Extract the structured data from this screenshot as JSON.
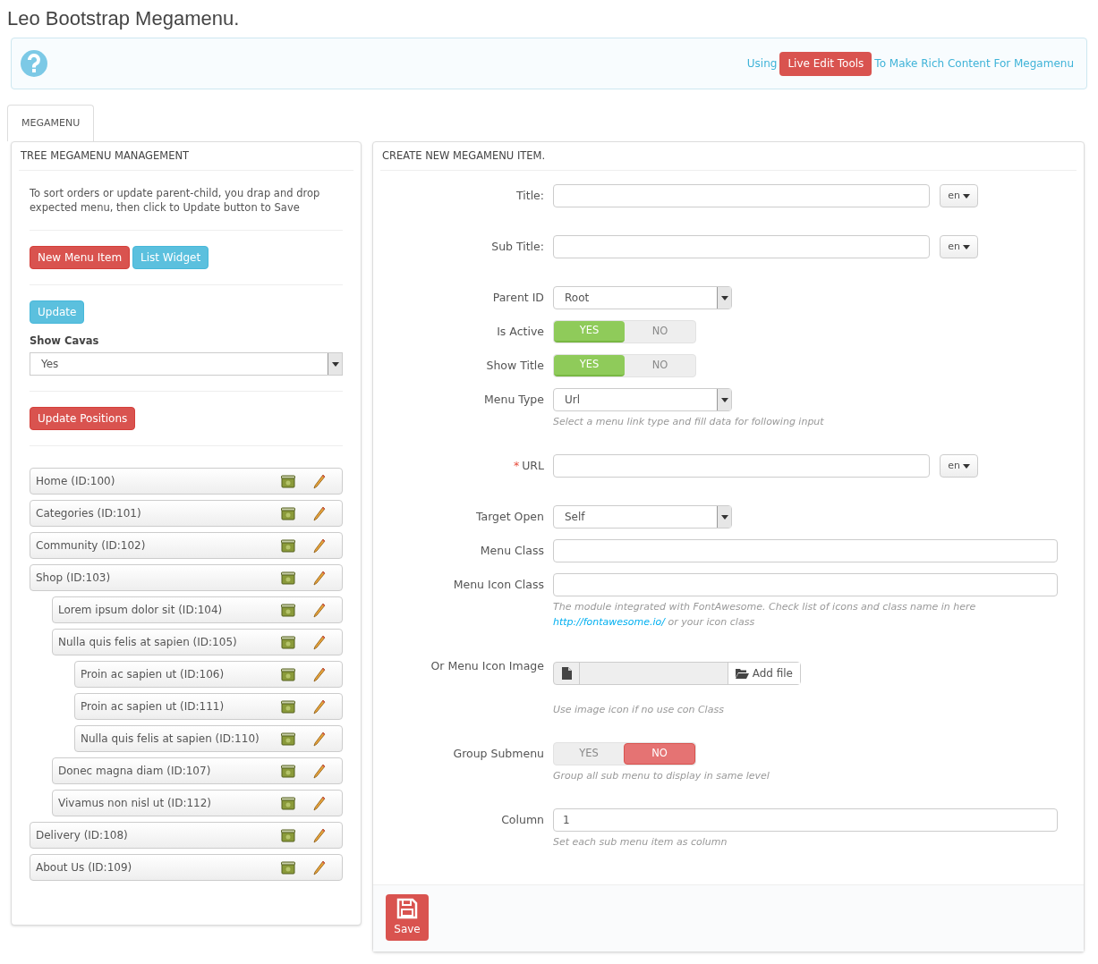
{
  "page_title": "Leo Bootstrap Megamenu.",
  "help_banner": {
    "before": "Using",
    "button": "Live Edit Tools",
    "after": "To Make Rich Content For Megamenu"
  },
  "tabs": [
    {
      "label": "MEGAMENU",
      "selected": true
    }
  ],
  "tree_panel": {
    "title": "TREE MEGAMENU MANAGEMENT",
    "intro": "To sort orders or update parent-child, you drap and drop expected menu, then click to Update button to Save",
    "buttons": [
      {
        "label": "New Menu Item",
        "kind": "danger"
      },
      {
        "label": "List Widget",
        "kind": "info"
      }
    ],
    "update_button": "Update",
    "show_cavas_label": "Show Cavas",
    "show_cavas_value": "Yes",
    "update_positions_button": "Update Positions",
    "items": [
      {
        "label": "Home (ID:100)"
      },
      {
        "label": "Categories (ID:101)"
      },
      {
        "label": "Community (ID:102)"
      },
      {
        "label": "Shop (ID:103)",
        "children": [
          {
            "label": "Lorem ipsum dolor sit (ID:104)"
          },
          {
            "label": "Nulla quis felis at sapien (ID:105)",
            "children": [
              {
                "label": "Proin ac sapien ut (ID:106)"
              },
              {
                "label": "Proin ac sapien ut (ID:111)"
              },
              {
                "label": "Nulla quis felis at sapien (ID:110)"
              }
            ]
          },
          {
            "label": "Donec magna diam (ID:107)"
          },
          {
            "label": "Vivamus non nisl ut (ID:112)"
          }
        ]
      },
      {
        "label": "Delivery (ID:108)"
      },
      {
        "label": "About Us (ID:109)"
      }
    ]
  },
  "form_panel": {
    "title": "CREATE NEW MEGAMENU ITEM.",
    "fields": [
      {
        "kind": "text_lang",
        "label": "Title:",
        "lang": "en"
      },
      {
        "kind": "text_lang",
        "label": "Sub Title:",
        "lang": "en"
      },
      {
        "kind": "select",
        "label": "Parent ID",
        "value": "Root"
      },
      {
        "kind": "toggle",
        "label": "Is Active",
        "yes": "YES",
        "no": "NO",
        "on": true
      },
      {
        "kind": "toggle",
        "label": "Show Title",
        "yes": "YES",
        "no": "NO",
        "on": true
      },
      {
        "kind": "select",
        "label": "Menu Type",
        "value": "Url",
        "help": "Select a menu link type and fill data for following input"
      },
      {
        "kind": "text_lang",
        "label": "URL",
        "required": true,
        "required_mark": "*",
        "lang": "en"
      },
      {
        "kind": "select",
        "label": "Target Open",
        "value": "Self"
      },
      {
        "kind": "text",
        "label": "Menu Class"
      },
      {
        "kind": "text",
        "label": "Menu Icon Class",
        "help": "The module integrated with FontAwesome. Check list of icons and class name in here",
        "help_link": "http://fontawesome.io/",
        "help_after": "or your icon class"
      },
      {
        "kind": "file",
        "label": "Or Menu Icon Image",
        "button": "Add file",
        "help": "Use image icon if no use con Class"
      },
      {
        "kind": "toggle",
        "label": "Group Submenu",
        "yes": "YES",
        "no": "NO",
        "on": false,
        "help": "Group all sub menu to display in same level"
      },
      {
        "kind": "text",
        "label": "Column",
        "value": "1",
        "help": "Set each sub menu item as column"
      }
    ],
    "save_button": "Save"
  }
}
